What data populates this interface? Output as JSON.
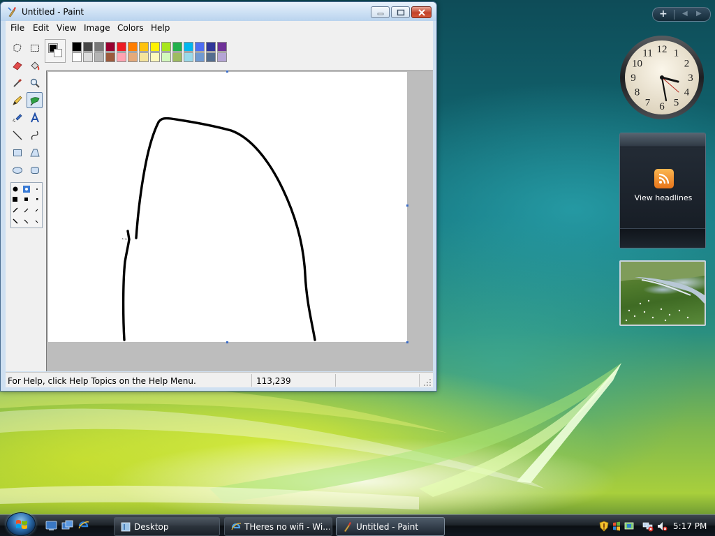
{
  "window": {
    "title": "Untitled - Paint"
  },
  "menu": {
    "file": "File",
    "edit": "Edit",
    "view": "View",
    "image": "Image",
    "colors": "Colors",
    "help": "Help"
  },
  "tools": [
    "free-form-select",
    "select",
    "eraser",
    "fill-with-color",
    "pick-color",
    "magnifier",
    "pencil",
    "brush",
    "airbrush",
    "text",
    "line",
    "curve",
    "rectangle",
    "polygon",
    "ellipse",
    "rounded-rectangle"
  ],
  "selected_tool": "brush",
  "palette": {
    "foreground": "#000000",
    "background": "#ffffff",
    "row1": [
      "#000000",
      "#464646",
      "#787878",
      "#990030",
      "#ed1c24",
      "#ff7e00",
      "#ffc20e",
      "#fff200",
      "#a8e61d",
      "#22b14c",
      "#00b7ef",
      "#4d6df3",
      "#2f3699",
      "#6f3198"
    ],
    "row2": [
      "#ffffff",
      "#dcdcdc",
      "#b4b4b4",
      "#9c5a3c",
      "#ffa3b1",
      "#e5aa7a",
      "#f5e49c",
      "#fff9bd",
      "#d3f9bc",
      "#9dbb61",
      "#99d9ea",
      "#709ad1",
      "#546d8e",
      "#b5a5d5"
    ]
  },
  "status": {
    "help": "For Help, click Help Topics on the Help Menu.",
    "coords": "113,239"
  },
  "gadgets": {
    "feed_label": "View headlines",
    "clock_numbers": [
      "12",
      "1",
      "2",
      "3",
      "4",
      "5",
      "6",
      "7",
      "8",
      "9",
      "10",
      "11"
    ]
  },
  "taskbar": {
    "tasks": [
      {
        "label": "Desktop"
      },
      {
        "label": "THeres no wifi - Wi..."
      },
      {
        "label": "Untitled - Paint"
      }
    ],
    "clock": "5:17 PM"
  }
}
